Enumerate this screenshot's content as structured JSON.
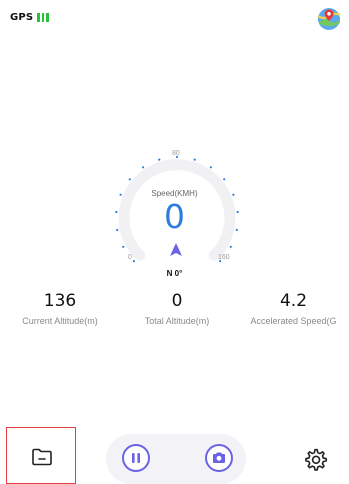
{
  "status_bar": {
    "gps_label": "GPS"
  },
  "gauge": {
    "speed_label": "Speed(KMH)",
    "speed_value": "0",
    "tick_min": "0",
    "tick_mid": "80",
    "tick_max": "160",
    "heading": "N 0°"
  },
  "stats": [
    {
      "value": "136",
      "label": "Current Altitude(m)"
    },
    {
      "value": "0",
      "label": "Total Altitude(m)"
    },
    {
      "value": "4.2",
      "label": "Accelerated Speed(G"
    }
  ],
  "icons": {
    "map": "map-pin-icon",
    "folder": "folder-icon",
    "pause": "pause-icon",
    "camera": "camera-icon",
    "settings": "gear-icon"
  },
  "colors": {
    "accent": "#2f7de1",
    "brand_purple": "#6b63e6",
    "gps_green": "#2bbf3a",
    "highlight_red": "#e14040"
  }
}
